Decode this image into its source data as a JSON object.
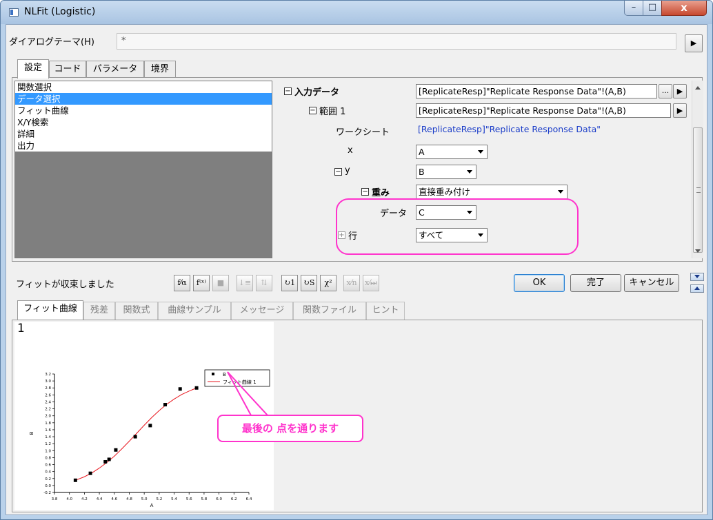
{
  "window": {
    "title": "NLFit (Logistic)",
    "minimize": "–",
    "maximize": "□",
    "close": "x"
  },
  "theme": {
    "label": "ダイアログテーマ(H)",
    "value": "*",
    "menu_arrow": "▶"
  },
  "top_tabs": [
    {
      "label": "設定",
      "active": true
    },
    {
      "label": "コード",
      "active": false
    },
    {
      "label": "パラメータ",
      "active": false
    },
    {
      "label": "境界",
      "active": false
    }
  ],
  "nav_items": [
    {
      "label": "関数選択",
      "selected": false
    },
    {
      "label": "データ選択",
      "selected": true
    },
    {
      "label": "フィット曲線",
      "selected": false
    },
    {
      "label": "X/Y検索",
      "selected": false
    },
    {
      "label": "詳細",
      "selected": false
    },
    {
      "label": "出力",
      "selected": false
    }
  ],
  "properties": {
    "input_data": {
      "toggle": "−",
      "label": "入力データ",
      "value": "[ReplicateResp]\"Replicate Response Data\"!(A,B)",
      "browse_label": "...",
      "menu_arrow": "▶"
    },
    "range1": {
      "toggle": "−",
      "label": "範囲 1",
      "value": "[ReplicateResp]\"Replicate Response Data\"!(A,B)",
      "menu_arrow": "▶"
    },
    "worksheet": {
      "label": "ワークシート",
      "value": "[ReplicateResp]\"Replicate Response Data\""
    },
    "x": {
      "label": "x",
      "value": "A"
    },
    "y": {
      "toggle": "−",
      "label": "y",
      "value": "B"
    },
    "weight": {
      "toggle": "−",
      "label": "重み",
      "value": "直接重み付け"
    },
    "weight_data": {
      "label": "データ",
      "value": "C"
    },
    "row": {
      "toggle": "+",
      "label": "行",
      "value": "すべて"
    }
  },
  "status": "フィットが収束しました",
  "toolbar": {
    "tools": [
      {
        "name": "fit-tool-icon",
        "glyph": "f⁄α",
        "enabled": true
      },
      {
        "name": "function-tool-icon",
        "glyph": "f⁽ˣ⁾",
        "enabled": true
      },
      {
        "name": "save-icon",
        "glyph": "■",
        "enabled": false
      },
      {
        "name": "sort-down-icon",
        "glyph": "↓≡",
        "enabled": false
      },
      {
        "name": "sort-up-icon",
        "glyph": "⇅",
        "enabled": false
      },
      {
        "name": "iterate-1-icon",
        "glyph": "↻1",
        "enabled": true
      },
      {
        "name": "iterate-until-converge-icon",
        "glyph": "↻S",
        "enabled": true
      },
      {
        "name": "chi-square-icon",
        "glyph": "χ²",
        "enabled": true
      },
      {
        "name": "fit-iteration-icon",
        "glyph": "x⁄n",
        "enabled": false
      },
      {
        "name": "fit-until-end-icon",
        "glyph": "x⁄⏭",
        "enabled": false
      }
    ]
  },
  "buttons": {
    "ok": "OK",
    "done": "完了",
    "cancel": "キャンセル"
  },
  "bottom_tabs": [
    {
      "label": "フィット曲線",
      "active": true
    },
    {
      "label": "残差",
      "active": false
    },
    {
      "label": "関数式",
      "active": false
    },
    {
      "label": "曲線サンプル",
      "active": false
    },
    {
      "label": "メッセージ",
      "active": false
    },
    {
      "label": "関数ファイル",
      "active": false
    },
    {
      "label": "ヒント",
      "active": false
    }
  ],
  "graph_layer_number": "1",
  "annotation": "最後の 点を通ります",
  "colors": {
    "selection": "#3399ff",
    "highlight": "#ff33cc",
    "fit_curve": "#e8141c",
    "link_text": "#1a3cc8"
  },
  "chart_data": {
    "type": "scatter",
    "xlabel": "A",
    "ylabel": "B",
    "xlim": [
      3.8,
      6.4
    ],
    "ylim": [
      -0.2,
      3.2
    ],
    "xticks": [
      "3.8",
      "4.0",
      "4.2",
      "4.4",
      "4.6",
      "4.8",
      "5.0",
      "5.2",
      "5.4",
      "5.6",
      "5.8",
      "6.0",
      "6.2",
      "6.4"
    ],
    "yticks": [
      "-0.2",
      "0.0",
      "0.2",
      "0.4",
      "0.6",
      "0.8",
      "1.0",
      "1.2",
      "1.4",
      "1.6",
      "1.8",
      "2.0",
      "2.2",
      "2.4",
      "2.6",
      "2.8",
      "3.0",
      "3.2"
    ],
    "legend": [
      {
        "name": "B",
        "kind": "scatter"
      },
      {
        "name": "フィット曲線 1",
        "kind": "line"
      }
    ],
    "series": [
      {
        "name": "B",
        "kind": "scatter",
        "x": [
          4.08,
          4.28,
          4.48,
          4.53,
          4.62,
          4.88,
          5.08,
          5.28,
          5.48,
          5.7
        ],
        "y": [
          0.15,
          0.35,
          0.68,
          0.75,
          1.02,
          1.4,
          1.72,
          2.32,
          2.77,
          2.8
        ]
      },
      {
        "name": "フィット曲線 1",
        "kind": "line",
        "x": [
          4.08,
          4.2,
          4.3,
          4.4,
          4.5,
          4.6,
          4.7,
          4.8,
          4.9,
          5.0,
          5.1,
          5.2,
          5.3,
          5.4,
          5.5,
          5.6,
          5.7
        ],
        "y": [
          0.15,
          0.25,
          0.36,
          0.5,
          0.66,
          0.84,
          1.05,
          1.27,
          1.5,
          1.73,
          1.95,
          2.15,
          2.33,
          2.48,
          2.61,
          2.71,
          2.8
        ]
      }
    ]
  }
}
